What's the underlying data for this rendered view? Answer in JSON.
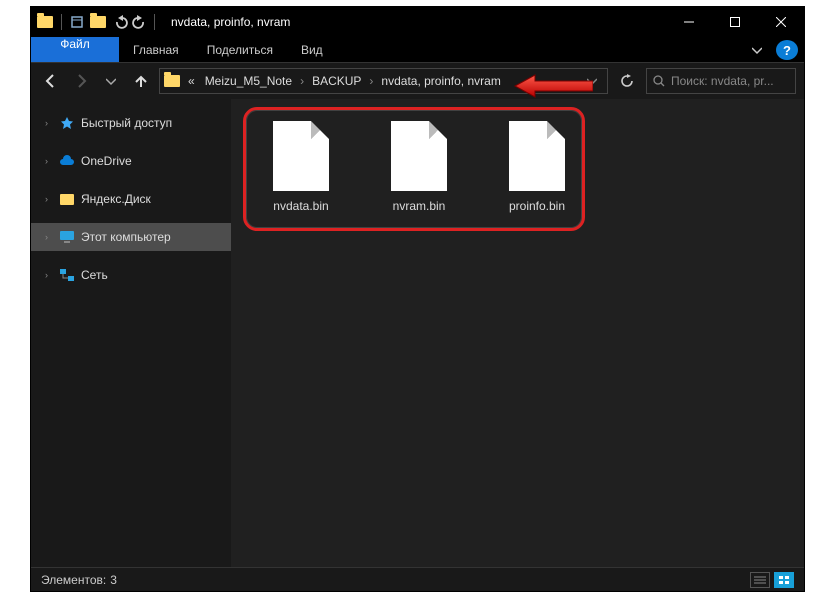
{
  "titlebar": {
    "title": "nvdata, proinfo, nvram"
  },
  "ribbon": {
    "file": "Файл",
    "home": "Главная",
    "share": "Поделиться",
    "view": "Вид"
  },
  "address": {
    "prefix": "«",
    "crumbs": [
      "Meizu_M5_Note",
      "BACKUP",
      "nvdata, proinfo, nvram"
    ]
  },
  "search": {
    "placeholder": "Поиск: nvdata, pr..."
  },
  "sidebar": {
    "items": [
      {
        "label": "Быстрый доступ",
        "caret": true
      },
      {
        "label": "OneDrive",
        "caret": true
      },
      {
        "label": "Яндекс.Диск",
        "caret": true
      },
      {
        "label": "Этот компьютер",
        "caret": true,
        "selected": true
      },
      {
        "label": "Сеть",
        "caret": true
      }
    ]
  },
  "files": [
    {
      "name": "nvdata.bin"
    },
    {
      "name": "nvram.bin"
    },
    {
      "name": "proinfo.bin"
    }
  ],
  "status": {
    "items_label": "Элементов:",
    "items_count": "3"
  }
}
